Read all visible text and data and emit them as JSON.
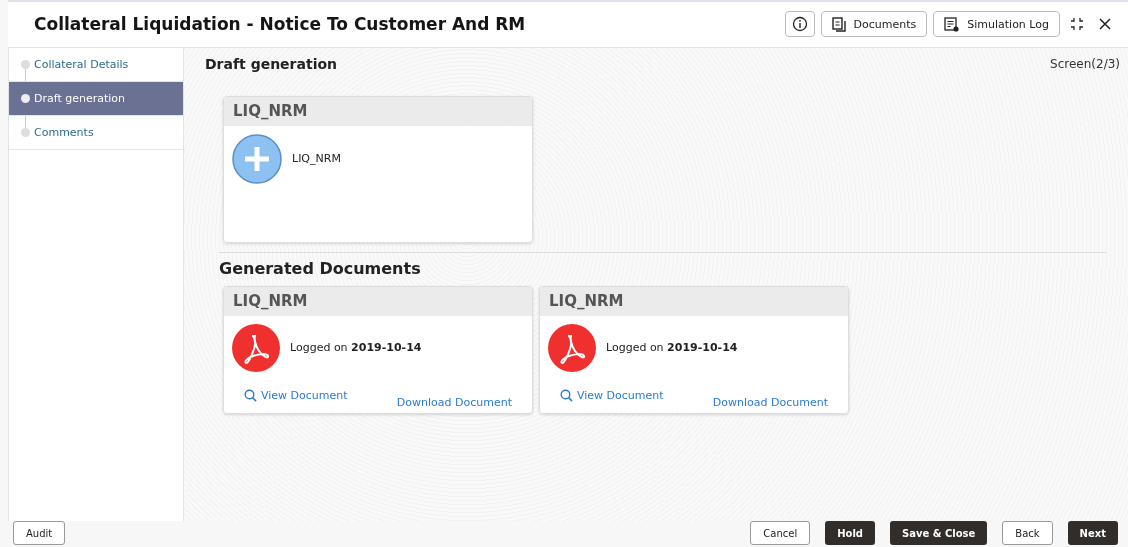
{
  "window": {
    "title": "Collateral Liquidation - Notice To Customer And RM"
  },
  "toolbar": [
    {
      "label": "Documents",
      "kind": "documents"
    },
    {
      "label": "Simulation Log",
      "kind": "log"
    }
  ],
  "sidebar": {
    "items": [
      {
        "label": "Collateral Details",
        "selected": false
      },
      {
        "label": "Draft generation",
        "selected": true
      },
      {
        "label": "Comments",
        "selected": false
      }
    ]
  },
  "section": {
    "title": "Draft generation",
    "screen": "Screen(2/3)"
  },
  "templates": [
    {
      "title": "LIQ_NRM",
      "name": "LIQ_NRM"
    }
  ],
  "generated": {
    "heading": "Generated Documents",
    "documents": [
      {
        "title": "LIQ_NRM",
        "logged": "Logged on **2019-10-14**",
        "view": "View Document",
        "download": "Download Document"
      },
      {
        "title": "LIQ_NRM",
        "logged": "Logged on **2019-10-14**",
        "view": "View Document",
        "download": "Download Document"
      }
    ]
  },
  "footer": {
    "left": [
      {
        "label": "Audit",
        "kind": "secondary"
      }
    ],
    "right": [
      {
        "label": "Cancel",
        "kind": "secondary"
      },
      {
        "label": "Hold",
        "kind": "primary"
      },
      {
        "label": "Save & Close",
        "kind": "primary"
      },
      {
        "label": "Back",
        "kind": "secondary"
      },
      {
        "label": "Next",
        "kind": "primary"
      }
    ]
  }
}
